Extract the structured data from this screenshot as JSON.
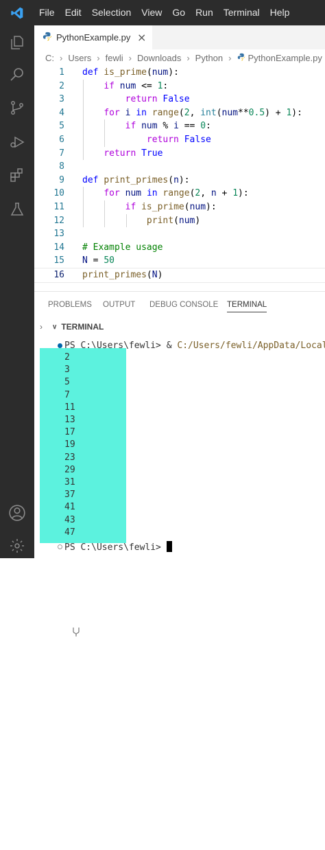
{
  "menu": [
    "File",
    "Edit",
    "Selection",
    "View",
    "Go",
    "Run",
    "Terminal",
    "Help"
  ],
  "activity_icons": [
    "explorer-icon",
    "search-icon",
    "source-control-icon",
    "run-debug-icon",
    "extensions-icon",
    "testing-icon",
    "account-icon",
    "gear-icon"
  ],
  "tab": {
    "label": "PythonExample.py",
    "close": "×"
  },
  "breadcrumb": [
    "C:",
    "Users",
    "fewli",
    "Downloads",
    "Python",
    "PythonExample.py"
  ],
  "code_lines": [
    {
      "n": "1",
      "html": "<span class='kw'>def</span> <span class='fn'>is_prime</span>(<span class='pm'>num</span>):"
    },
    {
      "n": "2",
      "html": "    <span class='ctl'>if</span> <span class='pm'>num</span> &lt;= <span class='nm'>1</span>:"
    },
    {
      "n": "3",
      "html": "        <span class='ctl'>return</span> <span class='kw'>False</span>"
    },
    {
      "n": "4",
      "html": "    <span class='ctl'>for</span> <span class='pm'>i</span> <span class='kw'>in</span> <span class='fn'>range</span>(<span class='nm'>2</span>, <span class='bi'>int</span>(<span class='pm'>num</span>**<span class='nm'>0.5</span>) + <span class='nm'>1</span>):"
    },
    {
      "n": "5",
      "html": "        <span class='ctl'>if</span> <span class='pm'>num</span> % <span class='pm'>i</span> == <span class='nm'>0</span>:"
    },
    {
      "n": "6",
      "html": "            <span class='ctl'>return</span> <span class='kw'>False</span>"
    },
    {
      "n": "7",
      "html": "    <span class='ctl'>return</span> <span class='kw'>True</span>"
    },
    {
      "n": "8",
      "html": ""
    },
    {
      "n": "9",
      "html": "<span class='kw'>def</span> <span class='fn'>print_primes</span>(<span class='pm'>n</span>):"
    },
    {
      "n": "10",
      "html": "    <span class='ctl'>for</span> <span class='pm'>num</span> <span class='kw'>in</span> <span class='fn'>range</span>(<span class='nm'>2</span>, <span class='pm'>n</span> + <span class='nm'>1</span>):"
    },
    {
      "n": "11",
      "html": "        <span class='ctl'>if</span> <span class='fn'>is_prime</span>(<span class='pm'>num</span>):"
    },
    {
      "n": "12",
      "html": "            <span class='fn'>print</span>(<span class='pm'>num</span>)"
    },
    {
      "n": "13",
      "html": ""
    },
    {
      "n": "14",
      "html": "<span class='cm'># Example usage</span>"
    },
    {
      "n": "15",
      "html": "<span class='pm'>N</span> = <span class='nm'>50</span>"
    },
    {
      "n": "16",
      "html": "<span class='fn'>print_primes</span>(<span class='pm'>N</span>)"
    }
  ],
  "panel_tabs": [
    "PROBLEMS",
    "OUTPUT",
    "DEBUG CONSOLE",
    "TERMINAL"
  ],
  "terminal_header": "TERMINAL",
  "terminal": {
    "prompt_start": "PS C:\\Users\\fewli> & ",
    "command_path": "C:/Users/fewli/AppData/Local/P",
    "output": [
      "2",
      "3",
      "5",
      "7",
      "11",
      "13",
      "17",
      "19",
      "23",
      "29",
      "31",
      "37",
      "41",
      "43",
      "47"
    ],
    "prompt_end": "PS C:\\Users\\fewli> "
  },
  "colors": {
    "highlight": "#5cf2de",
    "accent": "#0065a9"
  }
}
